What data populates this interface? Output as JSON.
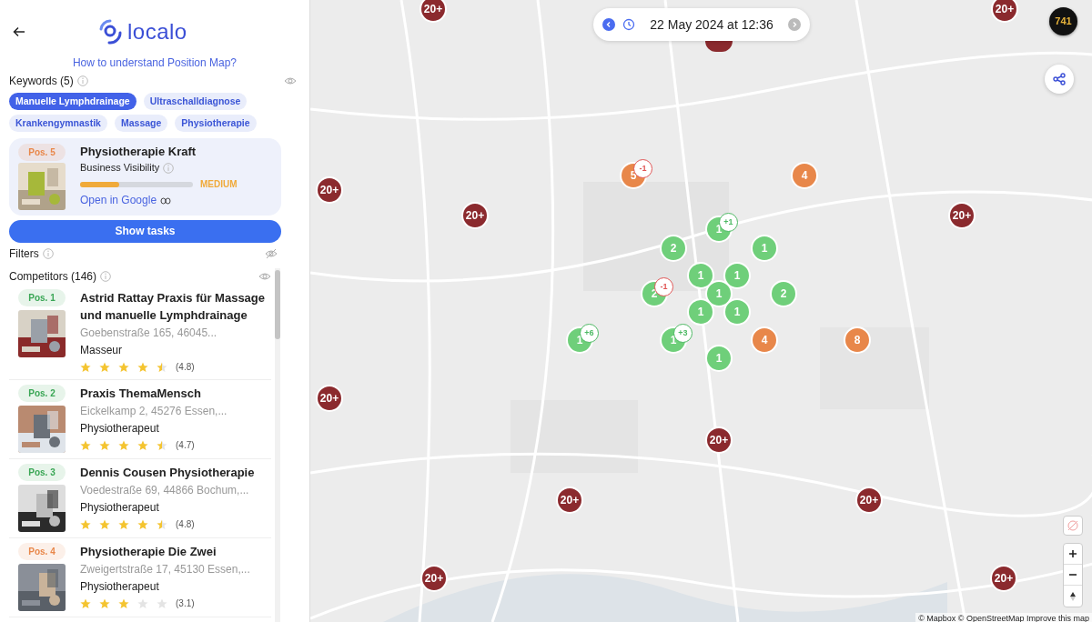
{
  "header": {
    "logo_text": "localo",
    "help_link": "How to understand Position Map?"
  },
  "keywords": {
    "title": "Keywords (5)",
    "items": [
      {
        "label": "Manuelle Lymphdrainage",
        "selected": true
      },
      {
        "label": "Ultraschalldiagnose",
        "selected": false
      },
      {
        "label": "Krankengymnastik",
        "selected": false
      },
      {
        "label": "Massage",
        "selected": false
      },
      {
        "label": "Physiotherapie",
        "selected": false
      }
    ]
  },
  "business": {
    "position": "Pos. 5",
    "color": "#e8874a",
    "name": "Physiotherapie Kraft",
    "visibility_label": "Business Visibility",
    "level": 0.35,
    "visibility_value": "MEDIUM",
    "link": "Open in Google",
    "button": "Show tasks"
  },
  "filters": {
    "title": "Filters"
  },
  "competitors": {
    "title": "Competitors (146)",
    "items": [
      {
        "position": "Pos. 1",
        "color": "#3aa655",
        "name": "Astrid Rattay Praxis für Massage und manuelle Lymphdrainage",
        "address": "Goebenstraße 165, 46045...",
        "category": "Masseur",
        "stars": 4.5,
        "rating": "(4.8)"
      },
      {
        "position": "Pos. 2",
        "color": "#3aa655",
        "name": "Praxis ThemaMensch",
        "address": "Eickelkamp 2, 45276 Essen,...",
        "category": "Physiotherapeut",
        "stars": 4.5,
        "rating": "(4.7)"
      },
      {
        "position": "Pos. 3",
        "color": "#3aa655",
        "name": "Dennis Cousen Physiotherapie",
        "address": "Voedestraße 69, 44866 Bochum,...",
        "category": "Physiotherapeut",
        "stars": 4.5,
        "rating": "(4.8)"
      },
      {
        "position": "Pos. 4",
        "color": "#e8874a",
        "name": "Physiotherapie Die Zwei",
        "address": "Zweigertstraße 17, 45130 Essen,...",
        "category": "Physiotherapeut",
        "stars": 3,
        "rating": "(3.1)"
      }
    ]
  },
  "map": {
    "date": "22 May 2024 at 12:36",
    "avatar_text": "741",
    "attribution": "© Mapbox © OpenStreetMap Improve this map",
    "markers": [
      {
        "label": "20+",
        "color": "#8b2a2e"
      },
      {
        "color": "#8b2a2e"
      },
      {
        "label": "20+",
        "color": "#8b2a2e"
      },
      {
        "label": "20+",
        "color": "#8b2a2e"
      },
      {
        "label": "20+",
        "color": "#8b2a2e"
      },
      {
        "label": "5",
        "color": "#e8874a",
        "change": {
          "label": "-1",
          "color": "#e05555"
        }
      },
      {
        "label": "4",
        "color": "#e8874a"
      },
      {
        "label": "20+",
        "color": "#8b2a2e"
      },
      {
        "label": "1",
        "color": "#6fcf7a",
        "change": {
          "label": "+1",
          "color": "#4cb963"
        }
      },
      {
        "label": "2",
        "color": "#6fcf7a"
      },
      {
        "label": "1",
        "color": "#6fcf7a"
      },
      {
        "label": "1",
        "color": "#6fcf7a"
      },
      {
        "label": "1",
        "color": "#6fcf7a"
      },
      {
        "label": "2",
        "color": "#6fcf7a",
        "change": {
          "label": "-1",
          "color": "#e05555"
        }
      },
      {
        "label": "1",
        "color": "#6fcf7a"
      },
      {
        "label": "2",
        "color": "#6fcf7a"
      },
      {
        "label": "1",
        "color": "#6fcf7a"
      },
      {
        "label": "1",
        "color": "#6fcf7a"
      },
      {
        "label": "1",
        "color": "#6fcf7a",
        "change": {
          "label": "+6",
          "color": "#4cb963"
        }
      },
      {
        "label": "1",
        "color": "#6fcf7a",
        "change": {
          "label": "+3",
          "color": "#4cb963"
        }
      },
      {
        "label": "4",
        "color": "#e8874a"
      },
      {
        "label": "8",
        "color": "#e8874a"
      },
      {
        "label": "1",
        "color": "#6fcf7a"
      },
      {
        "label": "20+",
        "color": "#8b2a2e"
      },
      {
        "label": "20+",
        "color": "#8b2a2e"
      },
      {
        "label": "20+",
        "color": "#8b2a2e"
      },
      {
        "label": "20+",
        "color": "#8b2a2e"
      },
      {
        "label": "20+",
        "color": "#8b2a2e"
      },
      {
        "label": "20+",
        "color": "#8b2a2e"
      }
    ]
  }
}
